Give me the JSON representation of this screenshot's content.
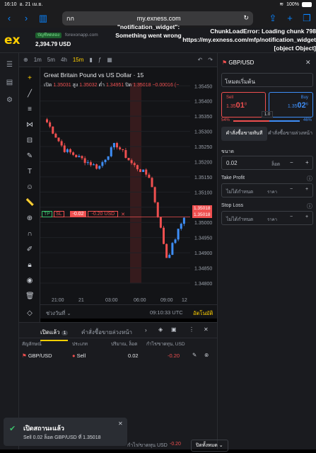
{
  "status": {
    "time": "16:10",
    "date": "อ. 21 เม.ย.",
    "battery": "100%"
  },
  "browser": {
    "tab_label": "กก",
    "url": "my.exness.com"
  },
  "account": {
    "type": "บัญชีทดลอง",
    "server": "forexonapp.com",
    "balance": "2,394.79 USD"
  },
  "errors": {
    "widget": "\"notification_widget\": Something went wrong",
    "chunk": "ChunkLoadError: Loading chunk 798 https://my.exness.com/mfp/notification_widget [object Object]"
  },
  "chart_toolbar": {
    "timeframes": [
      "1m",
      "5m",
      "4h",
      "15m"
    ],
    "active_tf": "15m"
  },
  "chart": {
    "title": "Great Britain Pound vs US Dollar · 15",
    "ohlc": {
      "open_label": "เปิด",
      "open": "1.35031",
      "high_label": "สูง",
      "high": "1.35032",
      "low_label": "ต่ำ",
      "low": "1.34951",
      "close_label": "ปิด",
      "close": "1.35018",
      "change": "−0.00016 (−"
    },
    "yticks": [
      "1.35450",
      "1.35400",
      "1.35350",
      "1.35300",
      "1.35250",
      "1.35200",
      "1.35150",
      "1.35100",
      "1.35050",
      "1.35000",
      "1.34950",
      "1.34900",
      "1.34850",
      "1.34800"
    ],
    "xticks": [
      "21:00",
      "21",
      "03:00",
      "06:00",
      "09:00",
      "12"
    ],
    "price_tags": [
      "1.35018",
      "1.35018"
    ],
    "tp_label": "TP",
    "sl_label": "SL",
    "position_pnl": "-0.02",
    "position_pnl_usd": "-0.20 USD",
    "range_label": "ช่วงวันที่",
    "clock": "09:10:33 UTC",
    "auto_label": "อัตโนมัติ"
  },
  "chart_data": {
    "type": "candlestick",
    "x": [
      "21:00",
      "03:00",
      "06:00",
      "09:00"
    ],
    "approx_closes": [
      1.3533,
      1.3524,
      1.3521,
      1.3518,
      1.3526,
      1.3519,
      1.3515,
      1.3488,
      1.3502
    ],
    "ylim": [
      1.348,
      1.3546
    ]
  },
  "order_panel": {
    "symbol": "GBP/USD",
    "mode": "โหมดเริ่มต้น",
    "sell_label": "Sell",
    "sell_price_main": "1.35",
    "sell_price_big": "01",
    "sell_price_sup": "8",
    "buy_label": "Buy",
    "buy_price_main": "1.35",
    "buy_price_big": "02",
    "buy_price_sup": "6",
    "spread": "1.0",
    "sell_pct": "54%",
    "buy_pct": "46%",
    "tab_market": "คำสั่งซื้อขายทันที",
    "tab_pending": "คำสั่งซื้อขายล่วงหน้า",
    "volume_label": "ขนาด",
    "volume_value": "0.02",
    "volume_unit": "ล็อต",
    "tp_label": "Take Profit",
    "tp_value": "ไม่ได้กำหนด",
    "tp_unit": "ราคา",
    "sl_label": "Stop Loss",
    "sl_value": "ไม่ได้กำหนด",
    "sl_unit": "ราคา"
  },
  "positions": {
    "tab_open": "เปิดแล้ว",
    "open_count": "1",
    "tab_pending": "คำสั่งซื้อขายล่วงหน้า",
    "col_symbol": "สัญลักษณ์",
    "col_type": "ประเภท",
    "col_volume": "ปริมาณ, ล็อต",
    "col_pnl": "กำไร/ขาดทุน, USD",
    "row": {
      "symbol": "GBP/USD",
      "type": "Sell",
      "volume": "0.02",
      "pnl": "-0.20"
    }
  },
  "toast": {
    "title": "เปิดสถานะแล้ว",
    "body": "Sell 0.02 ล็อต GBP/USD ที่ 1.35018"
  },
  "footer": {
    "pnl_label": "กำไร/ขาดทุน USD",
    "pnl_value": "-0.20",
    "close_all": "ปิดทั้งหมด"
  },
  "colors": {
    "accent": "#ffcf00",
    "up": "#3e8ef7",
    "down": "#ef4f4f"
  }
}
